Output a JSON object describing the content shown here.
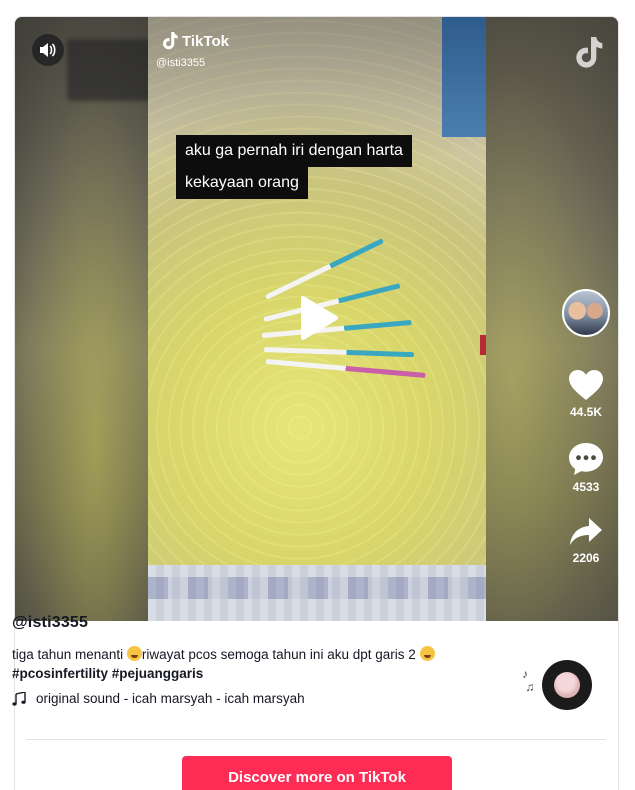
{
  "video": {
    "brand_name": "TikTok",
    "overlay_handle": "@isti3355",
    "caption_lines": [
      "aku ga pernah iri dengan harta",
      "kekayaan orang"
    ],
    "actions": {
      "likes": "44.5K",
      "comments": "4533",
      "shares": "2206"
    }
  },
  "post": {
    "author": "@isti3355",
    "description_part1": "tiga tahun menanti ",
    "description_part2": "riwayat pcos   semoga tahun ini aku dpt garis 2 ",
    "hashtags": "#pcosinfertility #pejuanggaris",
    "sound": "original sound - icah marsyah - icah marsyah"
  },
  "cta": {
    "discover_label": "Discover more on TikTok"
  },
  "colors": {
    "accent": "#fe2c55",
    "caption_bg": "#0d0d0d",
    "text": "#161823"
  },
  "icons": [
    "sound-on-icon",
    "tiktok-logo-icon",
    "play-icon",
    "heart-icon",
    "comment-icon",
    "share-icon",
    "music-note-icon"
  ]
}
